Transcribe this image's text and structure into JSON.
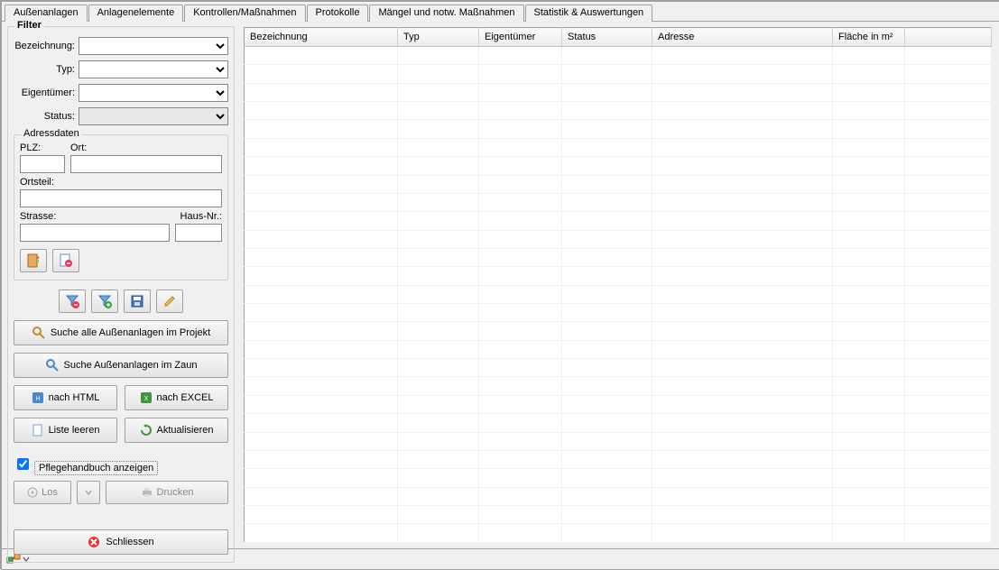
{
  "tabs": [
    "Außenanlagen",
    "Anlagenelemente",
    "Kontrollen/Maßnahmen",
    "Protokolle",
    "Mängel und notw. Maßnahmen",
    "Statistik & Auswertungen"
  ],
  "filter": {
    "title": "Filter",
    "labels": {
      "bezeichnung": "Bezeichnung:",
      "typ": "Typ:",
      "eigentuemer": "Eigentümer:",
      "status": "Status:"
    },
    "addr": {
      "title": "Adressdaten",
      "plz": "PLZ:",
      "ort": "Ort:",
      "ortsteil": "Ortsteil:",
      "strasse": "Strasse:",
      "hausnr": "Haus-Nr.:"
    },
    "buttons": {
      "search_project": "Suche alle Außenanlagen im Projekt",
      "search_fence": "Suche Außenanlagen im Zaun",
      "html": "nach HTML",
      "excel": "nach EXCEL",
      "clear_list": "Liste leeren",
      "refresh": "Aktualisieren",
      "handbook": "Pflegehandbuch anzeigen",
      "go": "Los",
      "print": "Drucken",
      "close": "Schliessen"
    }
  },
  "columns": {
    "bezeichnung": "Bezeichnung",
    "typ": "Typ",
    "eigentuemer": "Eigentümer",
    "status": "Status",
    "adresse": "Adresse",
    "flaeche": "Fläche in m²"
  }
}
